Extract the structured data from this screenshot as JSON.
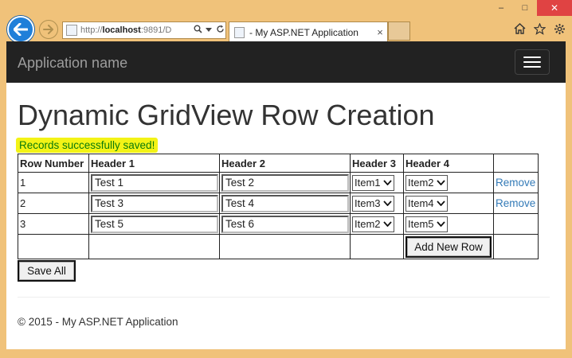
{
  "browser": {
    "url_prefix": "http://",
    "url_host": "localhost",
    "url_rest": ":9891/D",
    "tab_title": "- My ASP.NET Application",
    "tab_close": "×",
    "win_minimize": "–",
    "win_maximize": "□",
    "win_close": "✕"
  },
  "navbar": {
    "brand": "Application name"
  },
  "page": {
    "title": "Dynamic GridView Row Creation",
    "status_message": "Records successfully saved!"
  },
  "grid": {
    "headers": [
      "Row Number",
      "Header 1",
      "Header 2",
      "Header 3",
      "Header 4"
    ],
    "rows": [
      {
        "num": "1",
        "h1": "Test 1",
        "h2": "Test 2",
        "h3": "Item1",
        "h4": "Item2",
        "action": "Remove"
      },
      {
        "num": "2",
        "h1": "Test 3",
        "h2": "Test 4",
        "h3": "Item3",
        "h4": "Item4",
        "action": "Remove"
      },
      {
        "num": "3",
        "h1": "Test 5",
        "h2": "Test 6",
        "h3": "Item2",
        "h4": "Item5",
        "action": ""
      }
    ],
    "add_button": "Add New Row"
  },
  "save_button": "Save All",
  "footer": "© 2015 - My ASP.NET Application",
  "colors": {
    "chrome": "#f0c27a",
    "navbar": "#222222",
    "highlight": "#f3f316",
    "status_text": "#0a7a0a",
    "link": "#337ab7"
  }
}
